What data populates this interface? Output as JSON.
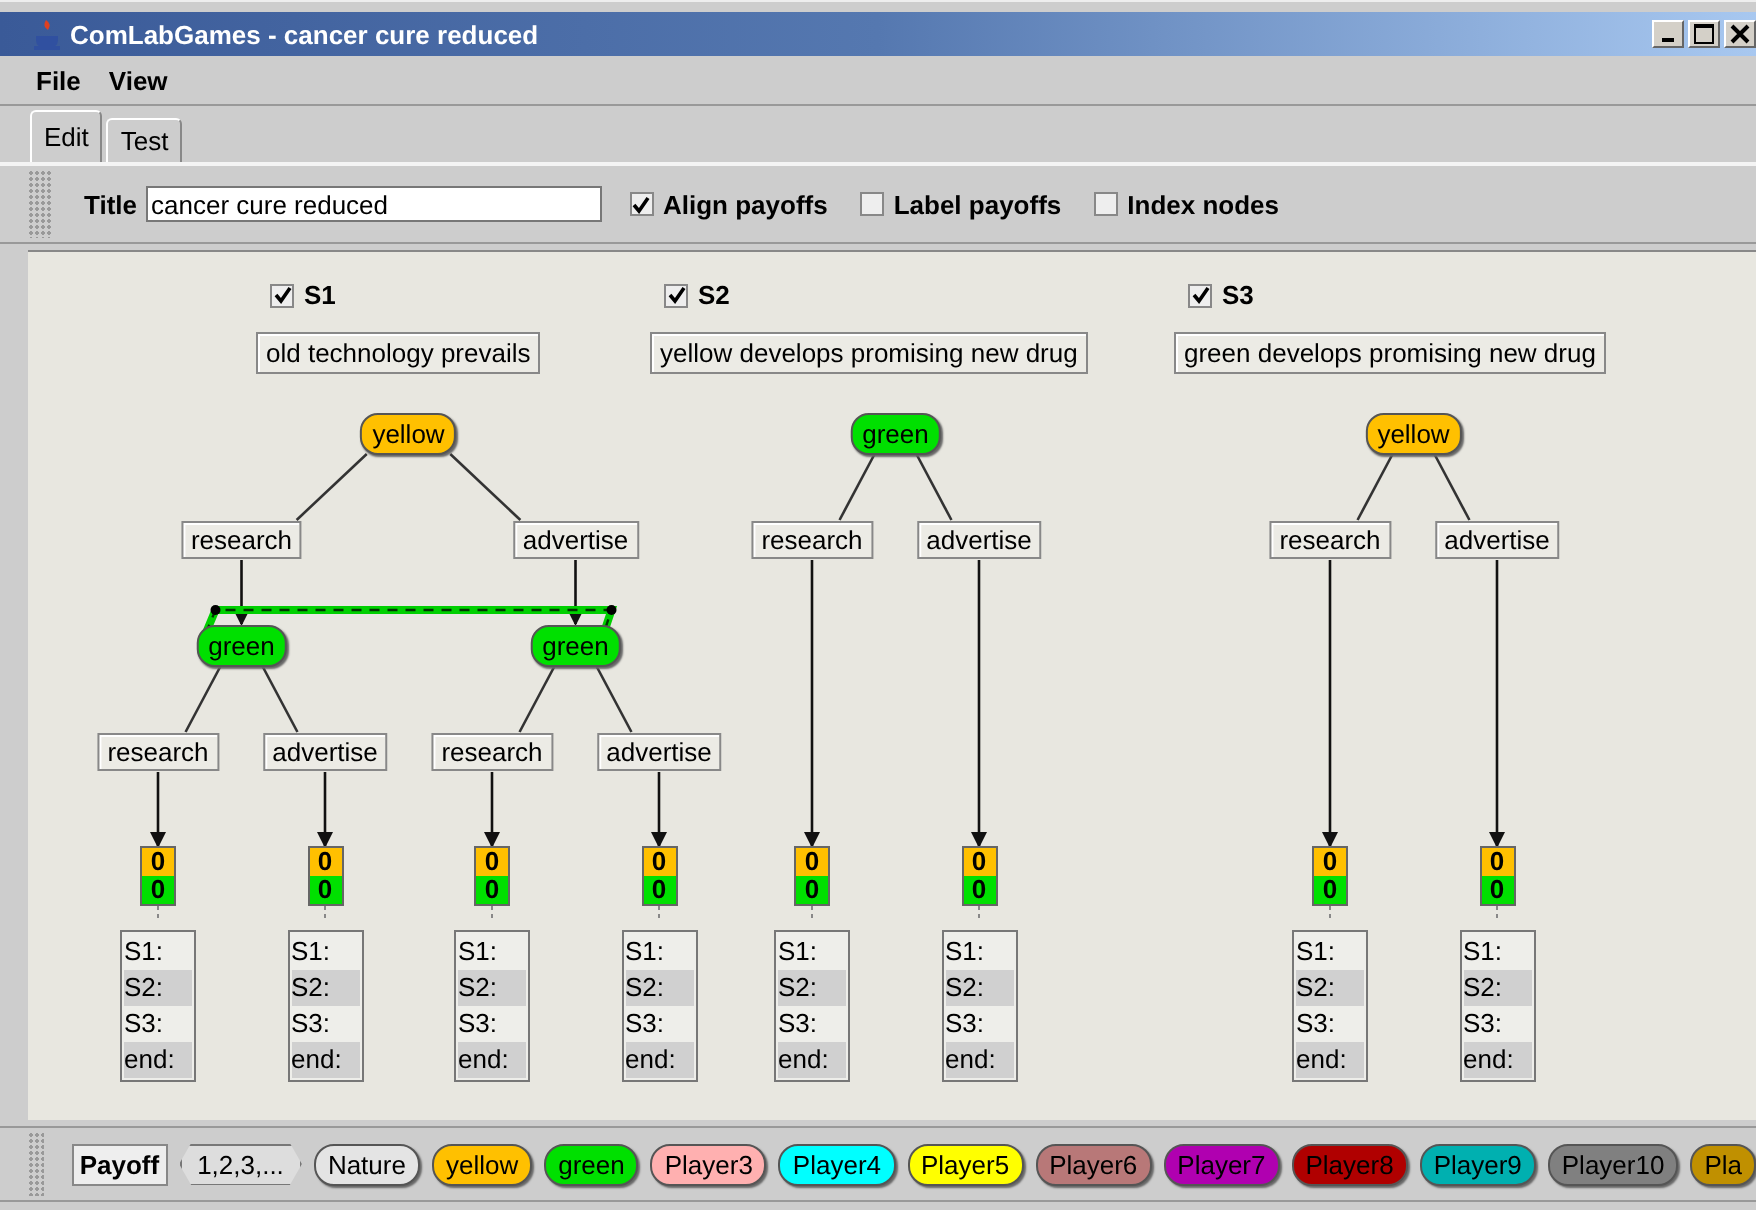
{
  "window": {
    "title": "ComLabGames - cancer cure reduced"
  },
  "menu": [
    "File",
    "View"
  ],
  "tabs": [
    {
      "label": "Edit",
      "selected": true
    },
    {
      "label": "Test",
      "selected": false
    }
  ],
  "toolbar": {
    "title_label": "Title",
    "title_value": "cancer cure reduced",
    "options": [
      {
        "label": "Align payoffs",
        "checked": true
      },
      {
        "label": "Label payoffs",
        "checked": false
      },
      {
        "label": "Index nodes",
        "checked": false
      }
    ]
  },
  "scenarios": [
    {
      "name": "S1",
      "checked": true,
      "description": "old technology prevails",
      "tree": {
        "player": "yellow",
        "color": "#ffc000",
        "moves": [
          {
            "label": "research",
            "child": {
              "player": "green",
              "color": "#00e000",
              "in_info_set": true,
              "moves": [
                {
                  "label": "research",
                  "child": {
                    "payoff": [
                      {
                        "value": "0",
                        "color": "#ffc000"
                      },
                      {
                        "value": "0",
                        "color": "#00e000"
                      }
                    ],
                    "outcomes": [
                      "S1:",
                      "S2:",
                      "S3:",
                      "end:"
                    ]
                  }
                },
                {
                  "label": "advertise",
                  "child": {
                    "payoff": [
                      {
                        "value": "0",
                        "color": "#ffc000"
                      },
                      {
                        "value": "0",
                        "color": "#00e000"
                      }
                    ],
                    "outcomes": [
                      "S1:",
                      "S2:",
                      "S3:",
                      "end:"
                    ]
                  }
                }
              ]
            }
          },
          {
            "label": "advertise",
            "child": {
              "player": "green",
              "color": "#00e000",
              "in_info_set": true,
              "moves": [
                {
                  "label": "research",
                  "child": {
                    "payoff": [
                      {
                        "value": "0",
                        "color": "#ffc000"
                      },
                      {
                        "value": "0",
                        "color": "#00e000"
                      }
                    ],
                    "outcomes": [
                      "S1:",
                      "S2:",
                      "S3:",
                      "end:"
                    ]
                  }
                },
                {
                  "label": "advertise",
                  "child": {
                    "payoff": [
                      {
                        "value": "0",
                        "color": "#ffc000"
                      },
                      {
                        "value": "0",
                        "color": "#00e000"
                      }
                    ],
                    "outcomes": [
                      "S1:",
                      "S2:",
                      "S3:",
                      "end:"
                    ]
                  }
                }
              ]
            }
          }
        ]
      }
    },
    {
      "name": "S2",
      "checked": true,
      "description": "yellow develops promising new drug",
      "tree": {
        "player": "green",
        "color": "#00e000",
        "moves": [
          {
            "label": "research",
            "child": {
              "payoff": [
                {
                  "value": "0",
                  "color": "#ffc000"
                },
                {
                  "value": "0",
                  "color": "#00e000"
                }
              ],
              "outcomes": [
                "S1:",
                "S2:",
                "S3:",
                "end:"
              ]
            }
          },
          {
            "label": "advertise",
            "child": {
              "payoff": [
                {
                  "value": "0",
                  "color": "#ffc000"
                },
                {
                  "value": "0",
                  "color": "#00e000"
                }
              ],
              "outcomes": [
                "S1:",
                "S2:",
                "S3:",
                "end:"
              ]
            }
          }
        ]
      }
    },
    {
      "name": "S3",
      "checked": true,
      "description": "green develops promising new drug",
      "tree": {
        "player": "yellow",
        "color": "#ffc000",
        "moves": [
          {
            "label": "research",
            "child": {
              "payoff": [
                {
                  "value": "0",
                  "color": "#ffc000"
                },
                {
                  "value": "0",
                  "color": "#00e000"
                }
              ],
              "outcomes": [
                "S1:",
                "S2:",
                "S3:",
                "end:"
              ]
            }
          },
          {
            "label": "advertise",
            "child": {
              "payoff": [
                {
                  "value": "0",
                  "color": "#ffc000"
                },
                {
                  "value": "0",
                  "color": "#00e000"
                }
              ],
              "outcomes": [
                "S1:",
                "S2:",
                "S3:",
                "end:"
              ]
            }
          }
        ]
      }
    }
  ],
  "palette": [
    {
      "label": "Payoff",
      "kind": "payoff"
    },
    {
      "label": "1,2,3,...",
      "kind": "sequence"
    },
    {
      "label": "Nature",
      "kind": "player",
      "color": "#e4e4e4"
    },
    {
      "label": "yellow",
      "kind": "player",
      "color": "#ffc000"
    },
    {
      "label": "green",
      "kind": "player",
      "color": "#00e000"
    },
    {
      "label": "Player3",
      "kind": "player",
      "color": "#ffb0b0"
    },
    {
      "label": "Player4",
      "kind": "player",
      "color": "#00ffff"
    },
    {
      "label": "Player5",
      "kind": "player",
      "color": "#ffff00"
    },
    {
      "label": "Player6",
      "kind": "player",
      "color": "#b87878"
    },
    {
      "label": "Player7",
      "kind": "player",
      "color": "#b000b0"
    },
    {
      "label": "Player8",
      "kind": "player",
      "color": "#b00000"
    },
    {
      "label": "Player9",
      "kind": "player",
      "color": "#00b0b0"
    },
    {
      "label": "Player10",
      "kind": "player",
      "color": "#808080"
    },
    {
      "label": "Pla",
      "kind": "player",
      "color": "#c09000"
    }
  ]
}
